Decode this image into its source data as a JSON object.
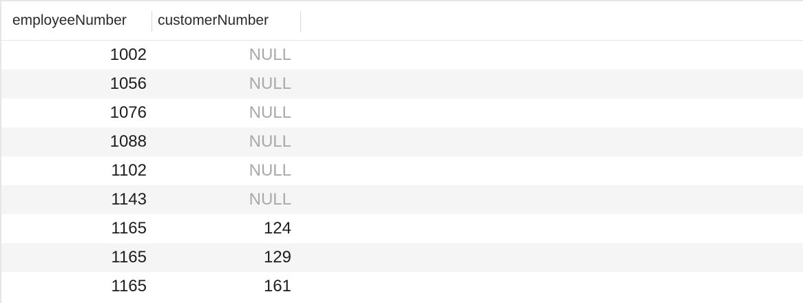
{
  "columns": [
    "employeeNumber",
    "customerNumber"
  ],
  "rows": [
    {
      "employeeNumber": "1002",
      "customerNumber": "NULL",
      "customer_is_null": true
    },
    {
      "employeeNumber": "1056",
      "customerNumber": "NULL",
      "customer_is_null": true
    },
    {
      "employeeNumber": "1076",
      "customerNumber": "NULL",
      "customer_is_null": true
    },
    {
      "employeeNumber": "1088",
      "customerNumber": "NULL",
      "customer_is_null": true
    },
    {
      "employeeNumber": "1102",
      "customerNumber": "NULL",
      "customer_is_null": true
    },
    {
      "employeeNumber": "1143",
      "customerNumber": "NULL",
      "customer_is_null": true
    },
    {
      "employeeNumber": "1165",
      "customerNumber": "124",
      "customer_is_null": false
    },
    {
      "employeeNumber": "1165",
      "customerNumber": "129",
      "customer_is_null": false
    },
    {
      "employeeNumber": "1165",
      "customerNumber": "161",
      "customer_is_null": false
    }
  ],
  "colors": {
    "alt_row_background": "#f4f5f4",
    "null_text": "#a9a9a9",
    "text": "#1d1d1f"
  }
}
